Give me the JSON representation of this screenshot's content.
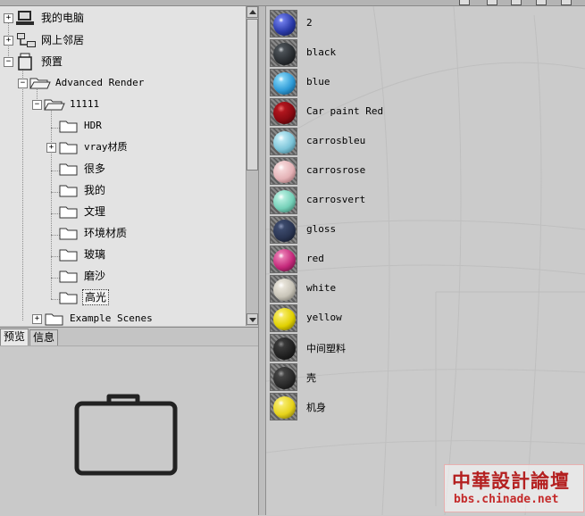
{
  "tree": {
    "nodes": [
      {
        "label": "我的电脑",
        "icon": "computer-icon",
        "expander": "+"
      },
      {
        "label": "网上邻居",
        "icon": "network-icon",
        "expander": "+"
      },
      {
        "label": "预置",
        "icon": "jar-icon",
        "expander": "−"
      },
      {
        "label": "Advanced Render",
        "icon": "folder-open-icon",
        "expander": "−"
      },
      {
        "label": "11111",
        "icon": "folder-open-icon",
        "expander": "−"
      },
      {
        "label": "HDR",
        "icon": "folder-icon",
        "expander": ""
      },
      {
        "label": "vray材质",
        "icon": "folder-icon",
        "expander": "+"
      },
      {
        "label": "很多",
        "icon": "folder-icon",
        "expander": ""
      },
      {
        "label": "我的",
        "icon": "folder-icon",
        "expander": ""
      },
      {
        "label": "文理",
        "icon": "folder-icon",
        "expander": ""
      },
      {
        "label": "环境材质",
        "icon": "folder-icon",
        "expander": ""
      },
      {
        "label": "玻璃",
        "icon": "folder-icon",
        "expander": ""
      },
      {
        "label": "磨沙",
        "icon": "folder-icon",
        "expander": ""
      },
      {
        "label": "高光",
        "icon": "folder-icon",
        "expander": "",
        "selected": true
      },
      {
        "label": "Example Scenes",
        "icon": "folder-icon",
        "expander": "+"
      }
    ]
  },
  "tabs": [
    {
      "label": "预览",
      "active": true
    },
    {
      "label": "信息",
      "active": false
    }
  ],
  "preview": {
    "icon": "folder-large-icon"
  },
  "materials": [
    {
      "name": "2",
      "color": "#2a3aa8"
    },
    {
      "name": "black",
      "color": "#2b2f33"
    },
    {
      "name": "blue",
      "color": "#2e9ad6"
    },
    {
      "name": "Car paint Red",
      "color": "#8a0a12"
    },
    {
      "name": "carrosbleu",
      "color": "#7cc4d8"
    },
    {
      "name": "carrosrose",
      "color": "#e4b2b6"
    },
    {
      "name": "carrosvert",
      "color": "#74d0b8"
    },
    {
      "name": "gloss",
      "color": "#2a3552"
    },
    {
      "name": "red",
      "color": "#c4287a"
    },
    {
      "name": "white",
      "color": "#c8c4b8"
    },
    {
      "name": "yellow",
      "color": "#e0d000"
    },
    {
      "name": "中间塑料",
      "color": "#222222"
    },
    {
      "name": "壳",
      "color": "#2a2a2a"
    },
    {
      "name": "机身",
      "color": "#e6d21a"
    }
  ],
  "watermark": {
    "title": "中華設計論壇",
    "url": "bbs.chinade.net"
  }
}
